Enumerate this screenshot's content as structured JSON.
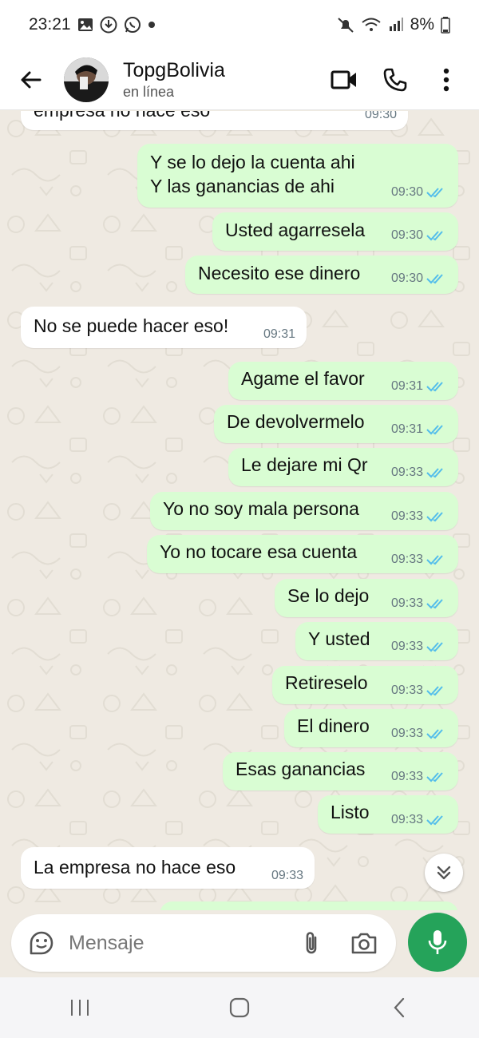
{
  "status_bar": {
    "time": "23:21",
    "battery": "8%",
    "left_icons": [
      "gallery-icon",
      "download-icon",
      "whatsapp-icon",
      "dot-icon"
    ],
    "right_icons": [
      "mute-icon",
      "wifi-icon",
      "signal-icon",
      "battery-icon"
    ]
  },
  "header": {
    "contact_name": "TopgBolivia",
    "contact_status": "en línea",
    "icons": [
      "back-arrow-icon",
      "video-call-icon",
      "phone-call-icon",
      "more-vert-icon"
    ]
  },
  "messages": [
    {
      "dir": "in",
      "lines": [
        "empresa no hace eso"
      ],
      "time": "09:30"
    },
    {
      "dir": "out",
      "lines": [
        "Y se lo dejo la cuenta ahi",
        "Y las ganancias de ahi"
      ],
      "time": "09:30"
    },
    {
      "dir": "out",
      "lines": [
        "Usted agarresela"
      ],
      "time": "09:30"
    },
    {
      "dir": "out",
      "lines": [
        "Necesito ese dinero"
      ],
      "time": "09:30"
    },
    {
      "dir": "in",
      "lines": [
        "No se puede hacer eso!"
      ],
      "time": "09:31"
    },
    {
      "dir": "out",
      "lines": [
        "Agame el favor"
      ],
      "time": "09:31"
    },
    {
      "dir": "out",
      "lines": [
        "De devolvermelo"
      ],
      "time": "09:31"
    },
    {
      "dir": "out",
      "lines": [
        "Le dejare mi Qr"
      ],
      "time": "09:33"
    },
    {
      "dir": "out",
      "lines": [
        "Yo no soy mala persona"
      ],
      "time": "09:33"
    },
    {
      "dir": "out",
      "lines": [
        "Yo no tocare esa cuenta"
      ],
      "time": "09:33"
    },
    {
      "dir": "out",
      "lines": [
        "Se lo dejo"
      ],
      "time": "09:33"
    },
    {
      "dir": "out",
      "lines": [
        "Y usted"
      ],
      "time": "09:33"
    },
    {
      "dir": "out",
      "lines": [
        "Retireselo"
      ],
      "time": "09:33"
    },
    {
      "dir": "out",
      "lines": [
        "El dinero"
      ],
      "time": "09:33"
    },
    {
      "dir": "out",
      "lines": [
        "Esas ganancias"
      ],
      "time": "09:33"
    },
    {
      "dir": "out",
      "lines": [
        "Listo"
      ],
      "time": "09:33"
    },
    {
      "dir": "in",
      "lines": [
        "La empresa no hace eso"
      ],
      "time": "09:33"
    }
  ],
  "composer": {
    "placeholder": "Mensaje",
    "icons": [
      "sticker-icon",
      "attach-icon",
      "camera-icon",
      "mic-icon"
    ]
  },
  "nav_bar": {
    "icons": [
      "recents-icon",
      "home-icon",
      "back-nav-icon"
    ]
  },
  "colors": {
    "chat_bg": "#efeae2",
    "outgoing_bubble": "#d9fdd3",
    "incoming_bubble": "#ffffff",
    "read_ticks": "#53bdeb",
    "mic_button": "#25a35a"
  }
}
